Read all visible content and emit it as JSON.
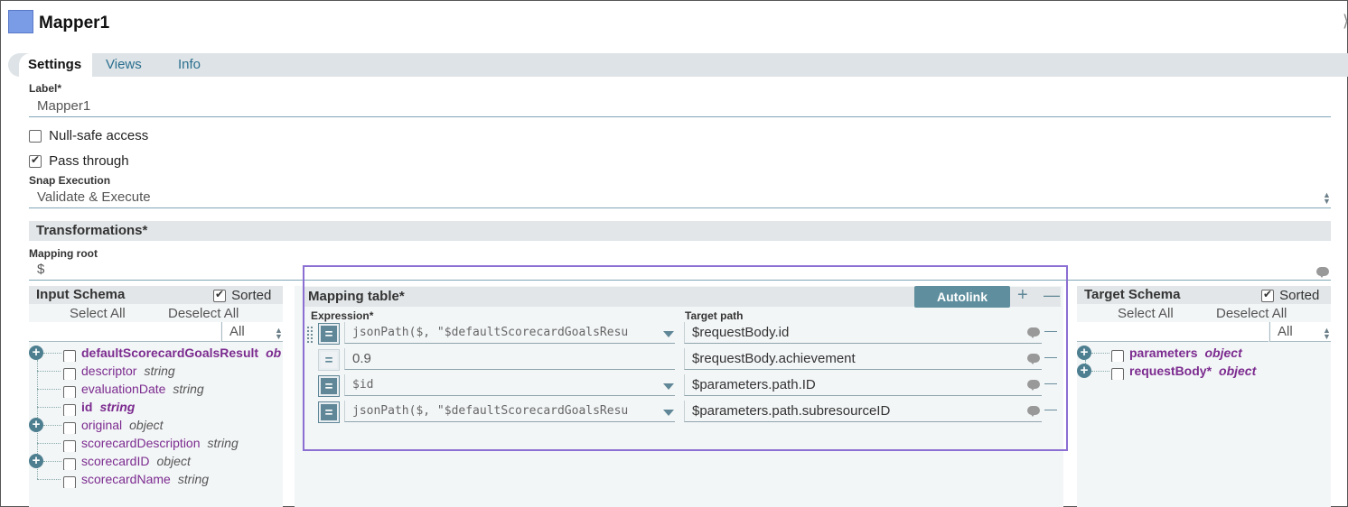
{
  "header": {
    "title": "Mapper1"
  },
  "tabs": [
    {
      "label": "Settings",
      "active": true
    },
    {
      "label": "Views"
    },
    {
      "label": "Info"
    }
  ],
  "settings": {
    "label_caption": "Label*",
    "label_value": "Mapper1",
    "null_safe_label": "Null-safe access",
    "null_safe_checked": false,
    "pass_through_label": "Pass through",
    "pass_through_checked": true,
    "snap_execution_caption": "Snap Execution",
    "snap_execution_value": "Validate & Execute"
  },
  "transformations": {
    "title": "Transformations*",
    "mapping_root_caption": "Mapping root",
    "mapping_root_value": "$"
  },
  "input_schema": {
    "title": "Input Schema",
    "sorted_label": "Sorted",
    "sorted_checked": true,
    "select_all": "Select All",
    "deselect_all": "Deselect All",
    "filter_value": "All",
    "items": [
      {
        "name": "defaultScorecardGoalsResult",
        "type": "ob",
        "bold": true,
        "expandable": true
      },
      {
        "name": "descriptor",
        "type": "string"
      },
      {
        "name": "evaluationDate",
        "type": "string"
      },
      {
        "name": "id",
        "type": "string",
        "bold": true
      },
      {
        "name": "original",
        "type": "object",
        "expandable": true
      },
      {
        "name": "scorecardDescription",
        "type": "string"
      },
      {
        "name": "scorecardID",
        "type": "object",
        "expandable": true
      },
      {
        "name": "scorecardName",
        "type": "string"
      }
    ]
  },
  "mapping_table": {
    "title": "Mapping table*",
    "autolink_label": "Autolink",
    "expression_header": "Expression*",
    "target_header": "Target path",
    "rows": [
      {
        "expression": "jsonPath($, \"$defaultScorecardGoalsResu",
        "target": "$requestBody.id",
        "mode": "dark",
        "dropdown": true,
        "mono": true
      },
      {
        "expression": "0.9",
        "target": "$requestBody.achievement",
        "mode": "light",
        "dropdown": false,
        "mono": false
      },
      {
        "expression": "$id",
        "target": "$parameters.path.ID",
        "mode": "dark",
        "dropdown": true,
        "mono": true
      },
      {
        "expression": "jsonPath($, \"$defaultScorecardGoalsResu",
        "target": "$parameters.path.subresourceID",
        "mode": "dark",
        "dropdown": true,
        "mono": true
      }
    ]
  },
  "target_schema": {
    "title": "Target Schema",
    "sorted_label": "Sorted",
    "sorted_checked": true,
    "select_all": "Select All",
    "deselect_all": "Deselect All",
    "filter_value": "All",
    "items": [
      {
        "name": "parameters",
        "type": "object",
        "bold": true,
        "expandable": true
      },
      {
        "name": "requestBody*",
        "type": "object",
        "bold": true,
        "expandable": true
      }
    ]
  },
  "icons": {
    "snap": "mapper-snap-icon",
    "eq": "=",
    "plus": "+",
    "minus": "–",
    "comment": "comment-bubble-icon"
  },
  "colors": {
    "accent": "#5f8797",
    "highlight_border": "#8b6fd2",
    "tree_name": "#7b2b8f"
  }
}
